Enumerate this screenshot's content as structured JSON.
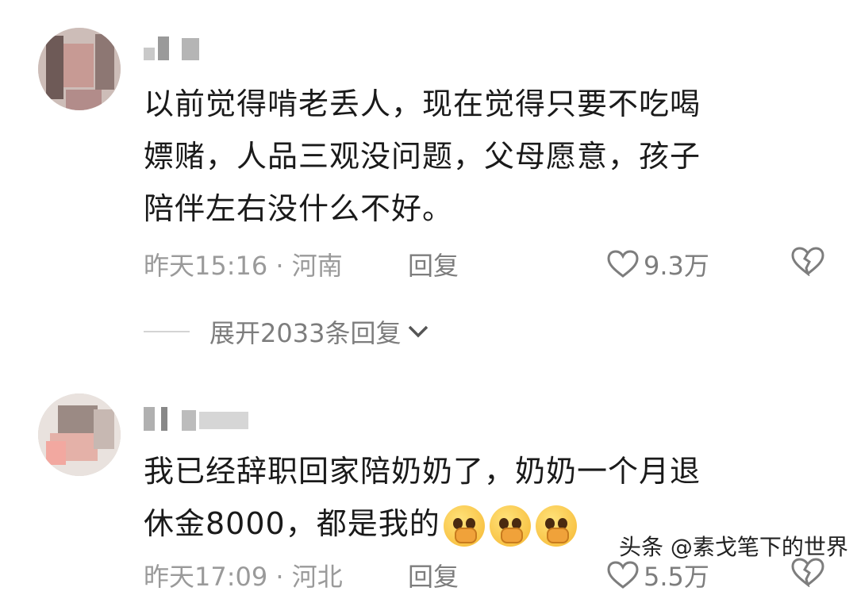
{
  "comments": [
    {
      "username": "",
      "text_lines": [
        "以前觉得啃老丢人，现在觉得只要不吃喝",
        "嫖赌，人品三观没问题，父母愿意，孩子",
        "陪伴左右没什么不好。"
      ],
      "time_location": "昨天15:16 · 河南",
      "reply_label": "回复",
      "likes": "9.3万",
      "expand_label": "展开2033条回复"
    },
    {
      "username": "",
      "text_lines": [
        "我已经辞职回家陪奶奶了，奶奶一个月退",
        "休金8000，都是我的"
      ],
      "emoji_count": 3,
      "time_location": "昨天17:09 · 河北",
      "reply_label": "回复",
      "likes": "5.5万"
    }
  ],
  "watermark": "头条 @素戈笔下的世界",
  "colors": {
    "text": "#1a1a1a",
    "meta": "#9a9a9a",
    "action": "#7d7d7d"
  },
  "icons": [
    "heart-icon",
    "broken-heart-icon",
    "chevron-down-icon"
  ]
}
